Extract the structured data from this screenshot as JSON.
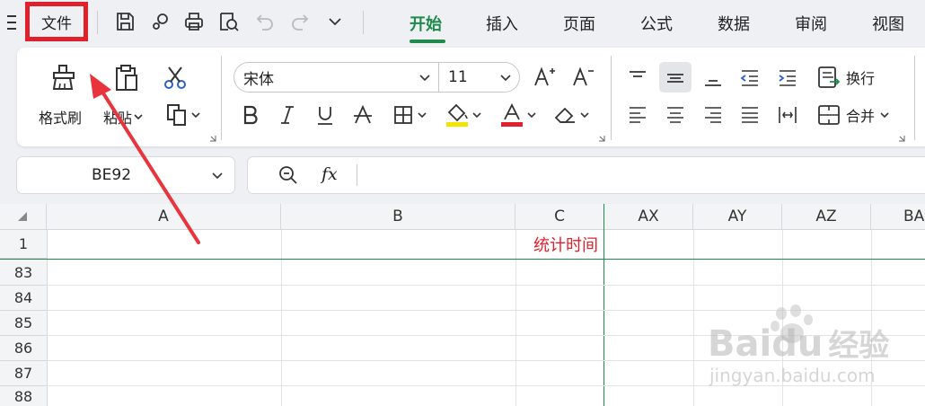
{
  "menu": {
    "file_label": "文件"
  },
  "tabs": [
    {
      "label": "开始",
      "active": true
    },
    {
      "label": "插入"
    },
    {
      "label": "页面"
    },
    {
      "label": "公式"
    },
    {
      "label": "数据"
    },
    {
      "label": "审阅"
    },
    {
      "label": "视图"
    }
  ],
  "ribbon": {
    "format_painter_label": "格式刷",
    "paste_label": "粘贴",
    "font_name": "宋体",
    "font_size": "11",
    "wrap_label": "换行",
    "merge_label": "合并"
  },
  "colors": {
    "accent_green": "#1f8a4c",
    "highlight_yellow": "#f5e400",
    "font_red": "#e0202a",
    "annotation_red": "#e8343c"
  },
  "formula_bar": {
    "name_box": "BE92",
    "fx_label": "fx",
    "content": ""
  },
  "sheet": {
    "columns": [
      "A",
      "B",
      "C",
      "AX",
      "AY",
      "AZ",
      "BA"
    ],
    "rows": [
      "1",
      "83",
      "84",
      "85",
      "86",
      "87",
      "88"
    ],
    "cell_C1": "统计时间"
  },
  "watermark": {
    "brand": "Baidu",
    "brand_cn": "经验",
    "url": "jingyan.baidu.com"
  }
}
